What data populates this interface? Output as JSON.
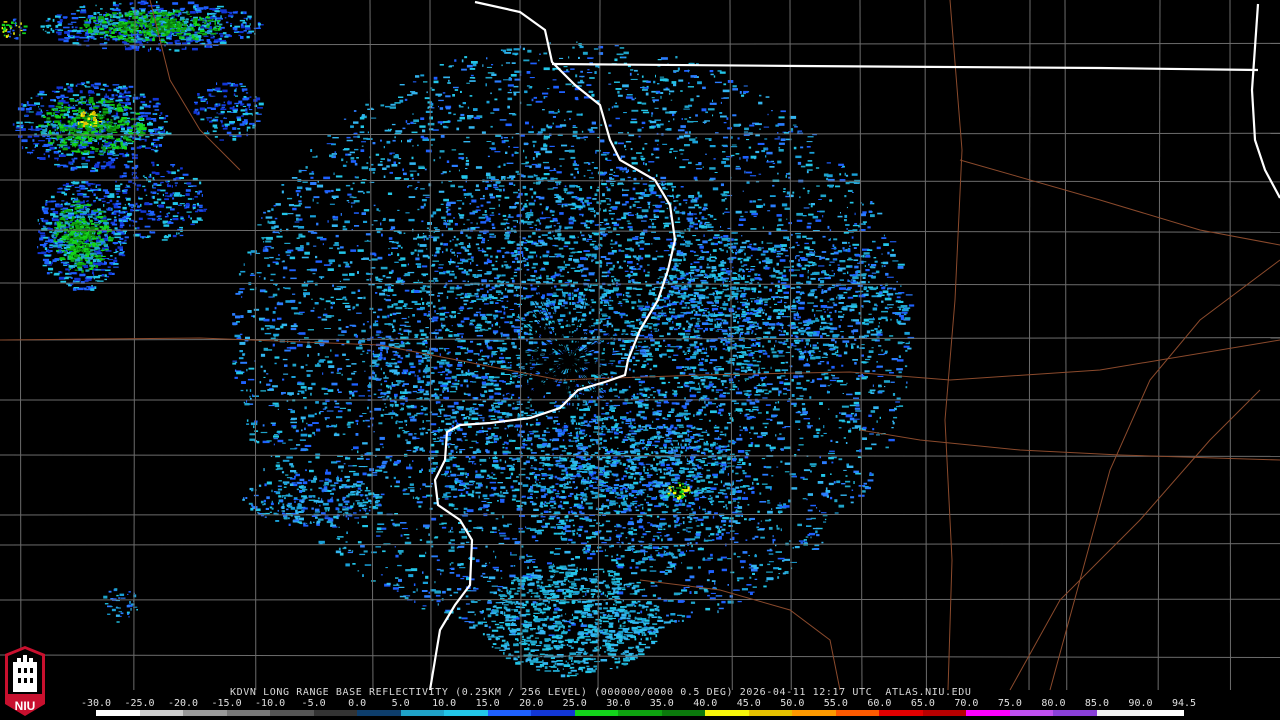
{
  "product_title": "KDVN LONG RANGE BASE REFLECTIVITY (0.25KM / 256 LEVEL) (000000/0000 0.5 DEG) 2026-04-11 12:17 UTC  ATLAS.NIU.EDU",
  "logo_text": "NIU",
  "scale": {
    "values": [
      "-30.0",
      "-25.0",
      "-20.0",
      "-15.0",
      "-10.0",
      "-5.0",
      "0.0",
      "5.0",
      "10.0",
      "15.0",
      "20.0",
      "25.0",
      "30.0",
      "35.0",
      "40.0",
      "45.0",
      "50.0",
      "55.0",
      "60.0",
      "65.0",
      "70.0",
      "75.0",
      "80.0",
      "85.0",
      "90.0",
      "94.5"
    ],
    "colors": [
      "#ffffff",
      "#cccccc",
      "#999999",
      "#777777",
      "#555555",
      "#333333",
      "#0d3d6b",
      "#1fa3c9",
      "#22c6e8",
      "#1e60ff",
      "#1236d6",
      "#13d41b",
      "#0ea310",
      "#0b7a0c",
      "#f5f50a",
      "#e6c200",
      "#ff9a00",
      "#ff5a00",
      "#e40000",
      "#b80000",
      "#ff00ff",
      "#c050f0",
      "#8a40d8",
      "#f0f0f0",
      "#ffffff"
    ]
  },
  "colors": {
    "background": "#000000",
    "county_lines": "#6c6c6c",
    "state_lines": "#ffffff",
    "highways": "#8b4a2c",
    "logo_red": "#c8102e"
  }
}
